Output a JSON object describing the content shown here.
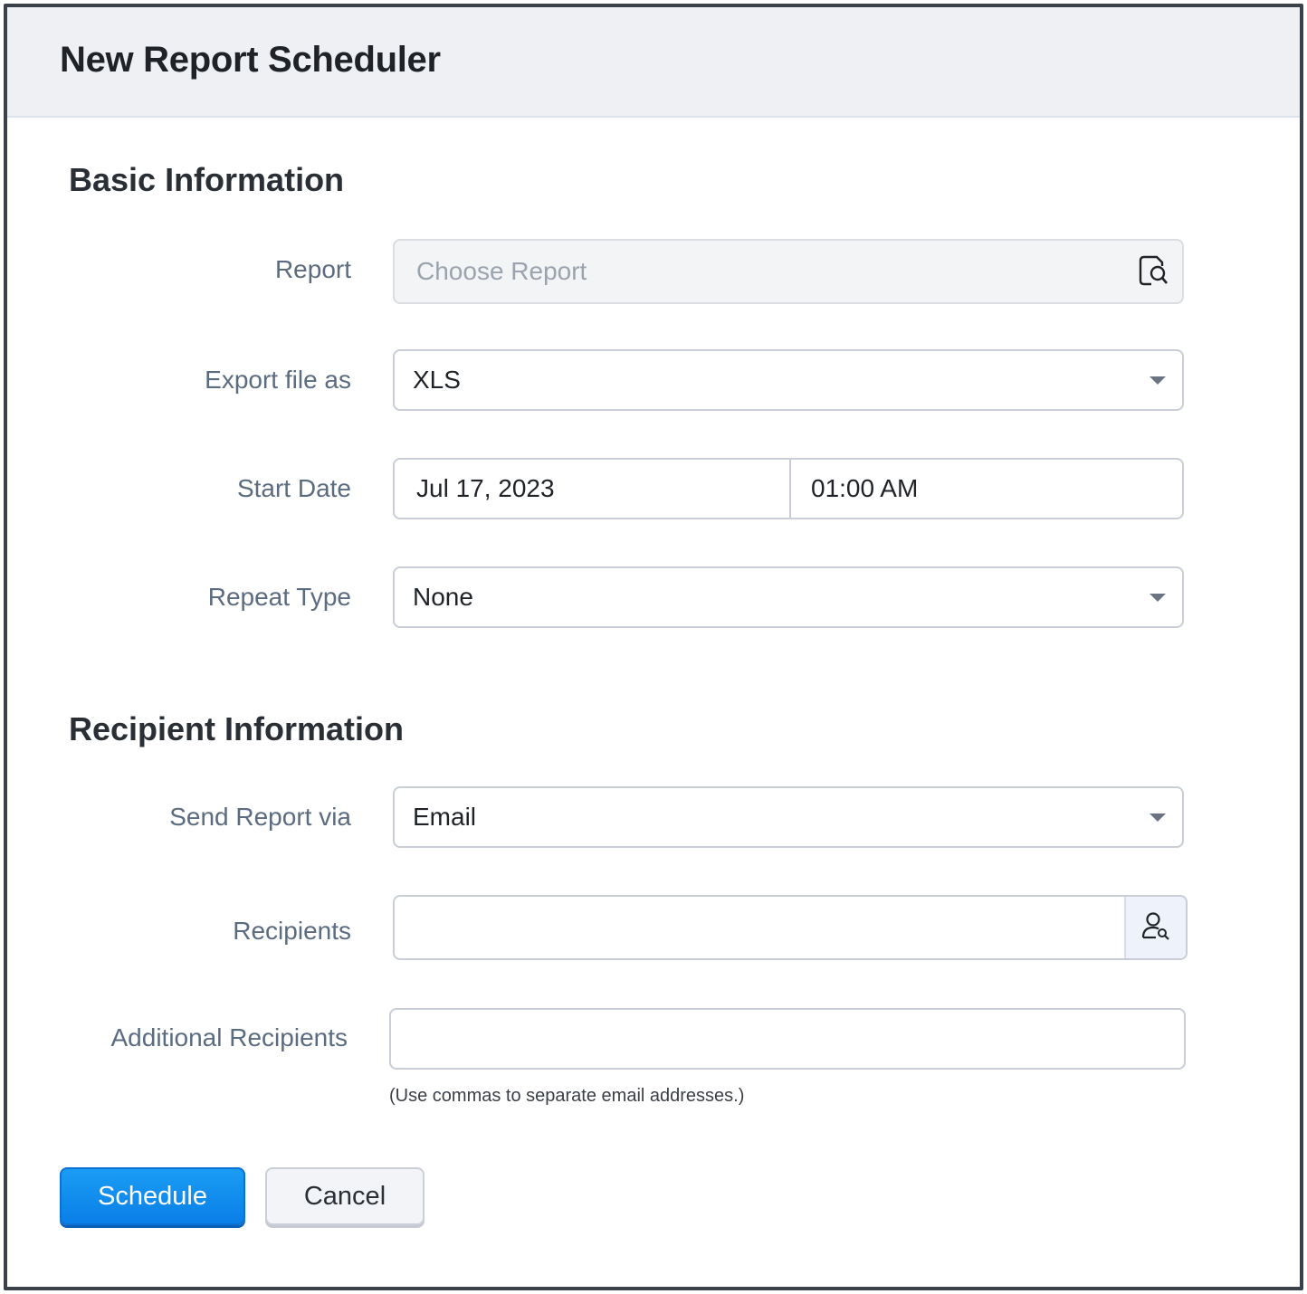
{
  "dialog": {
    "title": "New Report Scheduler"
  },
  "basic": {
    "heading": "Basic Information",
    "report": {
      "label": "Report",
      "placeholder": "Choose Report",
      "icon": "report-search-icon"
    },
    "export": {
      "label": "Export file as",
      "value": "XLS"
    },
    "start": {
      "label": "Start Date",
      "date": "Jul 17, 2023",
      "time": "01:00 AM"
    },
    "repeat": {
      "label": "Repeat Type",
      "value": "None"
    }
  },
  "recipient": {
    "heading": "Recipient Information",
    "send_via": {
      "label": "Send Report via",
      "value": "Email"
    },
    "recipients": {
      "label": "Recipients",
      "value": "",
      "icon": "user-search-icon"
    },
    "additional": {
      "label": "Additional Recipients",
      "value": "",
      "hint": "(Use commas to separate email addresses.)"
    }
  },
  "actions": {
    "schedule_label": "Schedule",
    "cancel_label": "Cancel"
  },
  "colors": {
    "primary": "#0a84f0",
    "label": "#5b6b80",
    "header_bg": "#eff0f3"
  }
}
